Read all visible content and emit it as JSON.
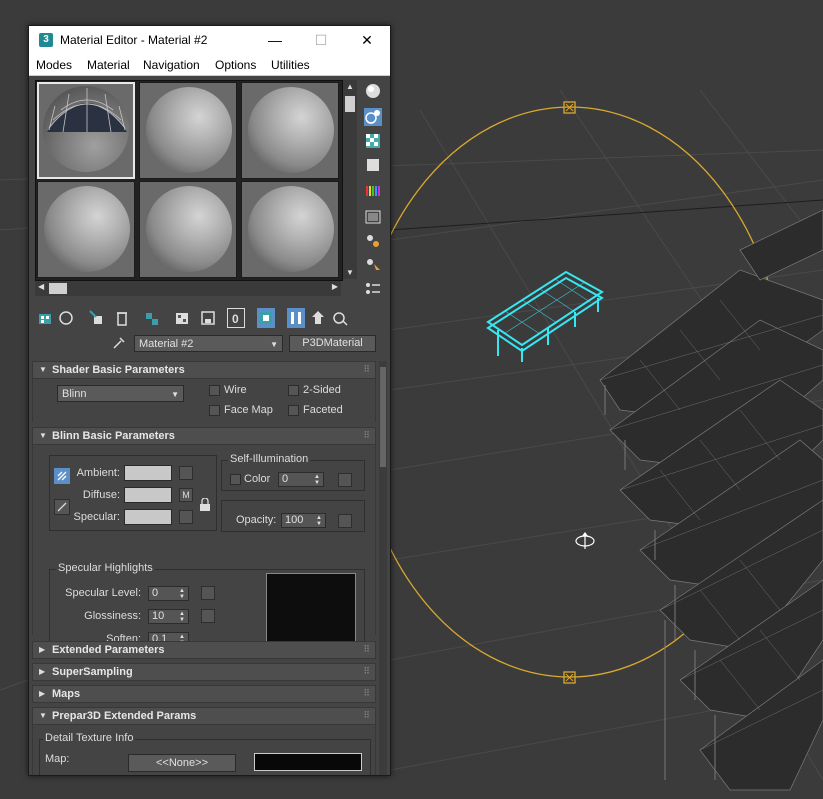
{
  "window": {
    "title": "Material Editor - Material #2",
    "app_icon": "3",
    "minimize": "—",
    "maximize": "☐",
    "close": "✕"
  },
  "menu": [
    "Modes",
    "Material",
    "Navigation",
    "Options",
    "Utilities"
  ],
  "material_row": {
    "name": "Material #2",
    "type_button": "P3DMaterial"
  },
  "shader_basic": {
    "header": "Shader Basic Parameters",
    "shader": "Blinn",
    "wire": "Wire",
    "two_sided": "2-Sided",
    "face_map": "Face Map",
    "faceted": "Faceted"
  },
  "blinn_basic": {
    "header": "Blinn Basic Parameters",
    "ambient": "Ambient:",
    "diffuse": "Diffuse:",
    "specular": "Specular:",
    "diffuse_map": "M",
    "self_illum_group": "Self-Illumination",
    "color_label": "Color",
    "color_value": "0",
    "opacity_label": "Opacity:",
    "opacity_value": "100",
    "spec_group": "Specular Highlights",
    "spec_level_label": "Specular Level:",
    "spec_level_value": "0",
    "glossiness_label": "Glossiness:",
    "glossiness_value": "10",
    "soften_label": "Soften:",
    "soften_value": "0.1"
  },
  "rollouts": {
    "extended": "Extended Parameters",
    "supersampling": "SuperSampling",
    "maps": "Maps",
    "prepar3d": "Prepar3D Extended Params"
  },
  "prepar3d": {
    "detail_group": "Detail Texture Info",
    "map_label": "Map:",
    "map_button": "<<None>>"
  },
  "colors": {
    "viewport_bg": "#3b3b3b",
    "selection": "#36e6f0",
    "helper_circle": "#d9a830"
  }
}
